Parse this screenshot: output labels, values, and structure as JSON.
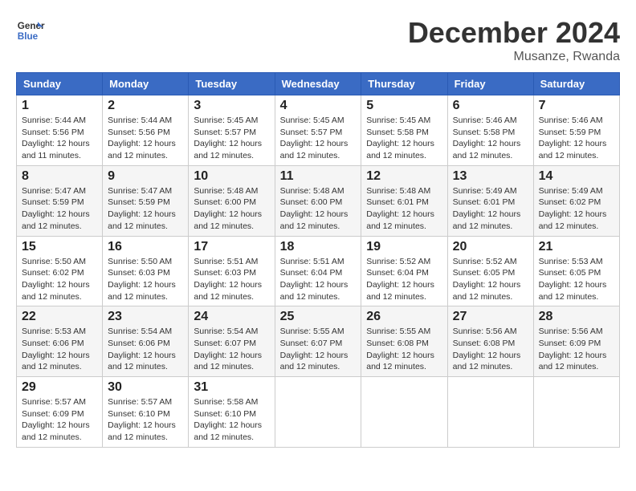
{
  "header": {
    "logo_line1": "General",
    "logo_line2": "Blue",
    "month_title": "December 2024",
    "location": "Musanze, Rwanda"
  },
  "weekdays": [
    "Sunday",
    "Monday",
    "Tuesday",
    "Wednesday",
    "Thursday",
    "Friday",
    "Saturday"
  ],
  "weeks": [
    [
      {
        "day": "1",
        "sunrise": "5:44 AM",
        "sunset": "5:56 PM",
        "daylight": "12 hours and 11 minutes."
      },
      {
        "day": "2",
        "sunrise": "5:44 AM",
        "sunset": "5:56 PM",
        "daylight": "12 hours and 12 minutes."
      },
      {
        "day": "3",
        "sunrise": "5:45 AM",
        "sunset": "5:57 PM",
        "daylight": "12 hours and 12 minutes."
      },
      {
        "day": "4",
        "sunrise": "5:45 AM",
        "sunset": "5:57 PM",
        "daylight": "12 hours and 12 minutes."
      },
      {
        "day": "5",
        "sunrise": "5:45 AM",
        "sunset": "5:58 PM",
        "daylight": "12 hours and 12 minutes."
      },
      {
        "day": "6",
        "sunrise": "5:46 AM",
        "sunset": "5:58 PM",
        "daylight": "12 hours and 12 minutes."
      },
      {
        "day": "7",
        "sunrise": "5:46 AM",
        "sunset": "5:59 PM",
        "daylight": "12 hours and 12 minutes."
      }
    ],
    [
      {
        "day": "8",
        "sunrise": "5:47 AM",
        "sunset": "5:59 PM",
        "daylight": "12 hours and 12 minutes."
      },
      {
        "day": "9",
        "sunrise": "5:47 AM",
        "sunset": "5:59 PM",
        "daylight": "12 hours and 12 minutes."
      },
      {
        "day": "10",
        "sunrise": "5:48 AM",
        "sunset": "6:00 PM",
        "daylight": "12 hours and 12 minutes."
      },
      {
        "day": "11",
        "sunrise": "5:48 AM",
        "sunset": "6:00 PM",
        "daylight": "12 hours and 12 minutes."
      },
      {
        "day": "12",
        "sunrise": "5:48 AM",
        "sunset": "6:01 PM",
        "daylight": "12 hours and 12 minutes."
      },
      {
        "day": "13",
        "sunrise": "5:49 AM",
        "sunset": "6:01 PM",
        "daylight": "12 hours and 12 minutes."
      },
      {
        "day": "14",
        "sunrise": "5:49 AM",
        "sunset": "6:02 PM",
        "daylight": "12 hours and 12 minutes."
      }
    ],
    [
      {
        "day": "15",
        "sunrise": "5:50 AM",
        "sunset": "6:02 PM",
        "daylight": "12 hours and 12 minutes."
      },
      {
        "day": "16",
        "sunrise": "5:50 AM",
        "sunset": "6:03 PM",
        "daylight": "12 hours and 12 minutes."
      },
      {
        "day": "17",
        "sunrise": "5:51 AM",
        "sunset": "6:03 PM",
        "daylight": "12 hours and 12 minutes."
      },
      {
        "day": "18",
        "sunrise": "5:51 AM",
        "sunset": "6:04 PM",
        "daylight": "12 hours and 12 minutes."
      },
      {
        "day": "19",
        "sunrise": "5:52 AM",
        "sunset": "6:04 PM",
        "daylight": "12 hours and 12 minutes."
      },
      {
        "day": "20",
        "sunrise": "5:52 AM",
        "sunset": "6:05 PM",
        "daylight": "12 hours and 12 minutes."
      },
      {
        "day": "21",
        "sunrise": "5:53 AM",
        "sunset": "6:05 PM",
        "daylight": "12 hours and 12 minutes."
      }
    ],
    [
      {
        "day": "22",
        "sunrise": "5:53 AM",
        "sunset": "6:06 PM",
        "daylight": "12 hours and 12 minutes."
      },
      {
        "day": "23",
        "sunrise": "5:54 AM",
        "sunset": "6:06 PM",
        "daylight": "12 hours and 12 minutes."
      },
      {
        "day": "24",
        "sunrise": "5:54 AM",
        "sunset": "6:07 PM",
        "daylight": "12 hours and 12 minutes."
      },
      {
        "day": "25",
        "sunrise": "5:55 AM",
        "sunset": "6:07 PM",
        "daylight": "12 hours and 12 minutes."
      },
      {
        "day": "26",
        "sunrise": "5:55 AM",
        "sunset": "6:08 PM",
        "daylight": "12 hours and 12 minutes."
      },
      {
        "day": "27",
        "sunrise": "5:56 AM",
        "sunset": "6:08 PM",
        "daylight": "12 hours and 12 minutes."
      },
      {
        "day": "28",
        "sunrise": "5:56 AM",
        "sunset": "6:09 PM",
        "daylight": "12 hours and 12 minutes."
      }
    ],
    [
      {
        "day": "29",
        "sunrise": "5:57 AM",
        "sunset": "6:09 PM",
        "daylight": "12 hours and 12 minutes."
      },
      {
        "day": "30",
        "sunrise": "5:57 AM",
        "sunset": "6:10 PM",
        "daylight": "12 hours and 12 minutes."
      },
      {
        "day": "31",
        "sunrise": "5:58 AM",
        "sunset": "6:10 PM",
        "daylight": "12 hours and 12 minutes."
      },
      null,
      null,
      null,
      null
    ]
  ],
  "labels": {
    "sunrise": "Sunrise:",
    "sunset": "Sunset:",
    "daylight": "Daylight:"
  }
}
